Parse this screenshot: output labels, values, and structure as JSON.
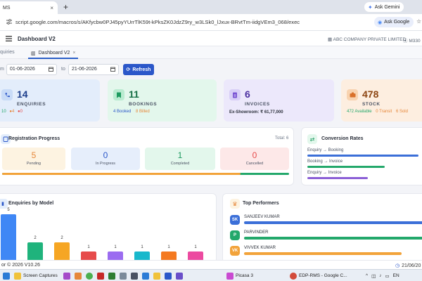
{
  "browser": {
    "tab_title": "MS",
    "new_tab": "+",
    "gemini": "Ask Gemini",
    "url": "script.google.com/macros/s/AKfycbw0PJ45pyYUrrTlK59t-kPksZK0JdzZ9ry_w3LSk0_lJxux-BRvtTm-iidgVEm3_068/exec",
    "ask_google": "Ask Google"
  },
  "app": {
    "title": "Dashboard V2",
    "company": "ABC COMPANY PRIVATE LIMITED",
    "location": "M330"
  },
  "page_tabs": [
    {
      "label": "quiries"
    },
    {
      "label": "Dashboard V2"
    }
  ],
  "filters": {
    "from_label": "m",
    "from_date": "01-06-2026",
    "to_label": "to",
    "to_date": "21-06-2026",
    "refresh": "Refresh"
  },
  "stats": {
    "enquiries": {
      "value": "14",
      "label": "ENQUIRIES",
      "sub1": "10",
      "sub2": "4",
      "sub3": "0"
    },
    "bookings": {
      "value": "11",
      "label": "BOOKINGS",
      "sub1": "4 Booked",
      "sub2": "8 Billed"
    },
    "invoices": {
      "value": "6",
      "label": "INVOICES",
      "sub1": "Ex-Showroom: ₹ 61,77,000"
    },
    "stock": {
      "value": "478",
      "label": "STOCK",
      "sub1": "472 Available",
      "sub2": "0 Transit",
      "sub3": "6 Sold"
    }
  },
  "registration": {
    "title": "Registration Progress",
    "total": "Total: 6",
    "boxes": [
      {
        "value": "5",
        "label": "Pending"
      },
      {
        "value": "0",
        "label": "In Progress"
      },
      {
        "value": "1",
        "label": "Completed"
      },
      {
        "value": "0",
        "label": "Cancelled"
      }
    ],
    "progress": 0.83
  },
  "conversion": {
    "title": "Conversion Rates",
    "rows": [
      {
        "label": "Enquiry → Booking",
        "rate": 0.79,
        "color": "#3b6fd8"
      },
      {
        "label": "Booking → Invoice",
        "rate": 0.55,
        "color": "#23a86b"
      },
      {
        "label": "Enquiry → Invoice",
        "rate": 0.43,
        "color": "#8b5fd6"
      }
    ]
  },
  "enquiries_by_model": {
    "title": "Enquiries by Model"
  },
  "chart_data": {
    "type": "bar",
    "title": "Enquiries by Model",
    "categories": [
      "",
      "",
      "",
      "",
      "",
      "",
      "",
      ""
    ],
    "values": [
      5,
      2,
      2,
      1,
      1,
      1,
      1,
      1
    ],
    "colors": [
      "#3f87f5",
      "#1fb37c",
      "#f6a623",
      "#e64b4b",
      "#9b6cf0",
      "#19b8cc",
      "#f47920",
      "#ec4aa0"
    ],
    "ylim": [
      0,
      5
    ]
  },
  "top_performers": {
    "title": "Top Performers",
    "rows": [
      {
        "initials": "SK",
        "name": "SANJEEV KUMAR",
        "color": "#3b6fd8",
        "level": 1.0
      },
      {
        "initials": "P",
        "name": "PARVINDER",
        "color": "#23a86b",
        "level": 1.0
      },
      {
        "initials": "VK",
        "name": "VIVVEK KUMAR",
        "color": "#f2a33a",
        "level": 0.86
      }
    ]
  },
  "footer": {
    "left": "or © 2026 V10.26",
    "right": "21/06/20"
  },
  "taskbar": [
    {
      "label": "Screen Captures",
      "color": "#f0c23a"
    },
    {
      "label": "Picasa 3",
      "color": "#c94bd1"
    },
    {
      "label": "EDP-RMS - Google C...",
      "color": "#d34b3a"
    },
    {
      "label": "EN",
      "color": "#999999"
    }
  ],
  "colors": {
    "primary": "#2b57c9",
    "enquiries_bg": "#e3edfb",
    "bookings_bg": "#e3f7ec",
    "invoices_bg": "#ece8fb",
    "stock_bg": "#fdeee0"
  }
}
